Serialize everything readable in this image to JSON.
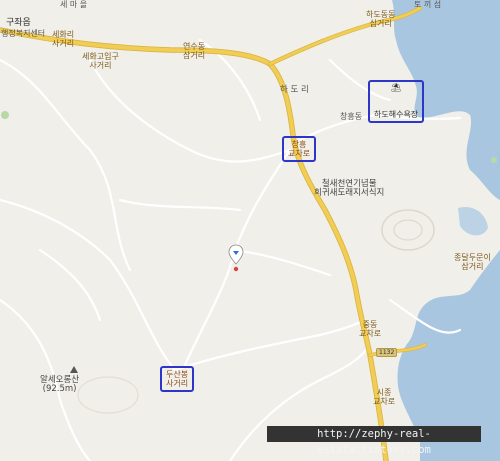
{
  "labels": {
    "gujwa_eup": "구좌읍",
    "welfare_center": "행정복지센터",
    "sehwa_ri_crossroad": "세화리\n사거리",
    "sehwa_high_crossroad": "세화고입구\n사거리",
    "yeonsudong_crossroad": "연수동\n삼거리",
    "hadori": "하 도 리",
    "hadodongdong_crossroad": "하도동동\n삼거리",
    "tokki_seom": "토 끼 섬",
    "hado_beach": "하도해수욕장",
    "changheungdong": "창흥동",
    "changheung_intersection": "창흥\n교차로",
    "bird_sanctuary": "철새천연기념물\n희귀새도래지서식지",
    "jongdal_crossroad": "종달두문이\n삼거리",
    "jungdong_intersection": "중동\n교차로",
    "dusanbong_crossroad": "두산봉\n사거리",
    "albaeoreum": "알세오롱산\n(92.5m)",
    "sijong_intersection": "시종\n교차로",
    "route_number": "1132",
    "top_village": "세 마 을"
  },
  "watermark": "http://zephy-real-estate.tistory.com",
  "colors": {
    "land": "#f1efe9",
    "sea": "#a9c6e0",
    "road_major": "#f2cd55",
    "road_minor": "#ffffff",
    "highlight_box": "#2d36c8",
    "marker": "#d64545"
  }
}
